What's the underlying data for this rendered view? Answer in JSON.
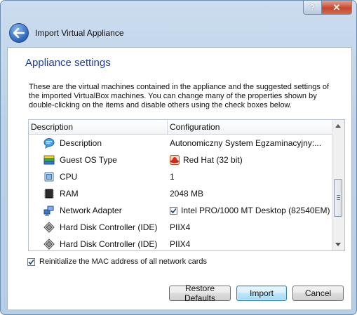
{
  "titlebar": {
    "help_label": "?",
    "close_label": "✕"
  },
  "header": {
    "title": "Import Virtual Appliance"
  },
  "section_title": "Appliance settings",
  "description": "These are the virtual machines contained in the appliance and the suggested settings of the imported VirtualBox machines. You can change many of the properties shown by double-clicking on the items and disable others using the check boxes below.",
  "table": {
    "columns": [
      "Description",
      "Configuration"
    ],
    "rows": [
      {
        "name": "Description",
        "value": "Autonomiczny System Egzaminacyjny:...",
        "icon": "speech-bubble-icon"
      },
      {
        "name": "Guest OS Type",
        "value": "Red Hat (32 bit)",
        "icon": "os-type-icon",
        "value_icon": "red-hat-icon"
      },
      {
        "name": "CPU",
        "value": "1",
        "icon": "cpu-icon"
      },
      {
        "name": "RAM",
        "value": "2048 MB",
        "icon": "ram-chip-icon"
      },
      {
        "name": "Network Adapter",
        "value": "Intel PRO/1000 MT Desktop (82540EM)",
        "icon": "network-adapter-icon",
        "checked": true
      },
      {
        "name": "Hard Disk Controller (IDE)",
        "value": "PIIX4",
        "icon": "disk-controller-icon"
      },
      {
        "name": "Hard Disk Controller (IDE)",
        "value": "PIIX4",
        "icon": "disk-controller-icon"
      }
    ]
  },
  "reinit": {
    "label": "Reinitialize the MAC address of all network cards",
    "checked": true
  },
  "buttons": {
    "restore": "Restore Defaults",
    "import": "Import",
    "cancel": "Cancel"
  },
  "colors": {
    "title_blue": "#1e3f9b",
    "primary_border": "#3c7fb1"
  }
}
